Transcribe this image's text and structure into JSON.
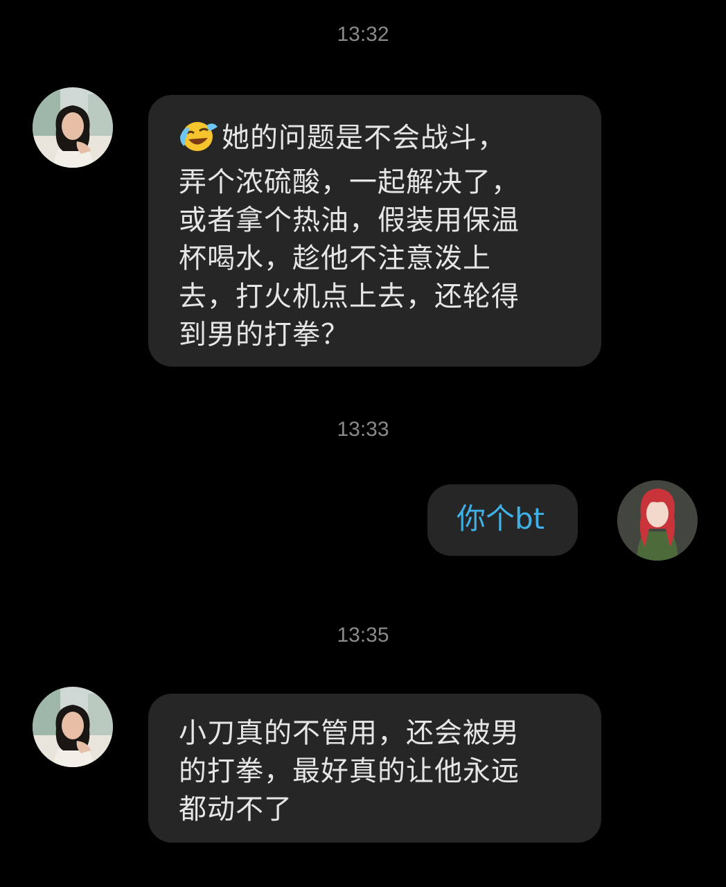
{
  "messages": [
    {
      "time": "13:32",
      "sender": "contact",
      "emoji": "crying-laughing-face",
      "lines": [
        "她的问题是不会战斗，",
        "弄个浓硫酸，一起解决了，",
        "或者拿个热油，假装用保温",
        "杯喝水，趁他不注意泼上",
        "去，打火机点上去，还轮得",
        "到男的打拳？"
      ]
    },
    {
      "time": "13:33",
      "sender": "self",
      "text": "你个bt"
    },
    {
      "time": "13:35",
      "sender": "contact",
      "lines": [
        "小刀真的不管用，还会被男",
        "的打拳，最好真的让他永远",
        "都动不了"
      ]
    }
  ],
  "colors": {
    "background": "#000000",
    "bubble": "#262626",
    "incoming_text": "#e6e6e6",
    "outgoing_text": "#3fb1e6",
    "timestamp": "#8a8a8a"
  }
}
